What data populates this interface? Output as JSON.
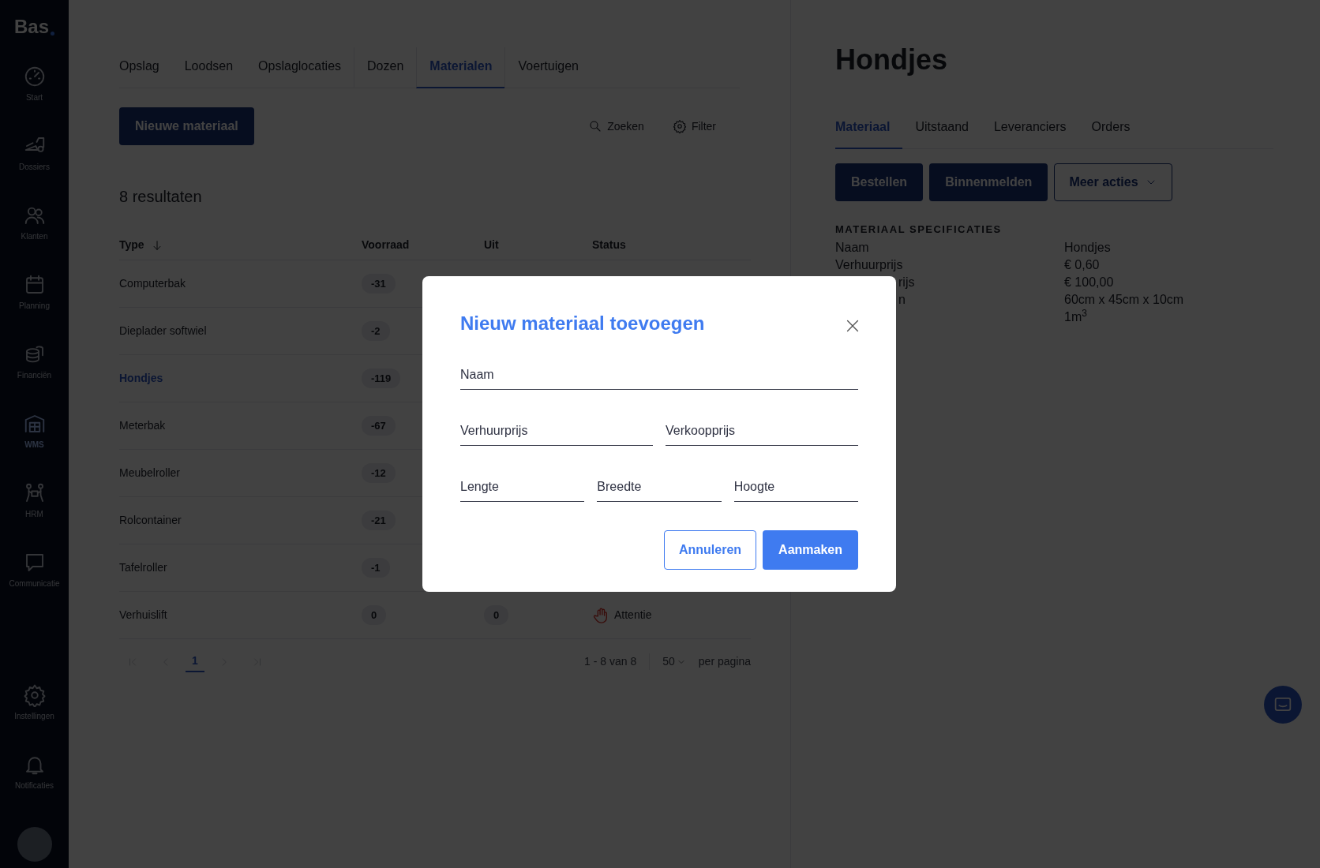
{
  "sidebar": {
    "logo": "Bas",
    "items": [
      {
        "label": "Start",
        "selected": false
      },
      {
        "label": "Dossiers",
        "selected": false
      },
      {
        "label": "Klanten",
        "selected": false
      },
      {
        "label": "Planning",
        "selected": false
      },
      {
        "label": "Financiën",
        "selected": false
      },
      {
        "label": "WMS",
        "selected": true
      },
      {
        "label": "HRM",
        "selected": false
      },
      {
        "label": "Communicatie",
        "selected": false
      }
    ],
    "bottom_items": [
      {
        "label": "Instellingen",
        "selected": false
      },
      {
        "label": "Notificaties",
        "selected": false
      }
    ]
  },
  "tabs": [
    {
      "label": "Opslag",
      "selected": false
    },
    {
      "label": "Loodsen",
      "selected": false
    },
    {
      "label": "Opslaglocaties",
      "selected": false
    },
    {
      "label": "Dozen",
      "selected": false
    },
    {
      "label": "Materialen",
      "selected": true
    },
    {
      "label": "Voertuigen",
      "selected": false
    }
  ],
  "new_button": "Nieuwe materiaal",
  "search": "Zoeken",
  "filter": "Filter",
  "results": "8 resultaten",
  "table": {
    "columns": [
      "Type",
      "Voorraad",
      "Uit",
      "Status"
    ],
    "rows": [
      {
        "type": "Computerbak",
        "stock": "-31",
        "selected": false
      },
      {
        "type": "Dieplader softwiel",
        "stock": "-2",
        "selected": false
      },
      {
        "type": "Hondjes",
        "stock": "-119",
        "selected": true
      },
      {
        "type": "Meterbak",
        "stock": "-67",
        "selected": false
      },
      {
        "type": "Meubelroller",
        "stock": "-12",
        "selected": false
      },
      {
        "type": "Rolcontainer",
        "stock": "-21",
        "selected": false
      },
      {
        "type": "Tafelroller",
        "stock": "-1",
        "selected": false
      },
      {
        "type": "Verhuislift",
        "stock": "0",
        "selected": false,
        "out": "0",
        "status": "Attentie"
      }
    ]
  },
  "pagination": {
    "pages": [
      {
        "label": "1",
        "selected": true
      }
    ],
    "range": "1 - 8 van 8",
    "per_page": "50",
    "per_page_label": "per pagina"
  },
  "detail": {
    "title": "Hondjes",
    "tabs": [
      {
        "label": "Materiaal",
        "selected": true
      },
      {
        "label": "Uitstaand",
        "selected": false
      },
      {
        "label": "Leveranciers",
        "selected": false
      },
      {
        "label": "Orders",
        "selected": false
      }
    ],
    "buttons": [
      {
        "label": "Bestellen",
        "kind": "primary"
      },
      {
        "label": "Binnenmelden",
        "kind": "primary"
      },
      {
        "label": "Meer acties",
        "kind": "dropdown"
      }
    ],
    "spec_heading": "MATERIAAL SPECIFICATIES",
    "specs": [
      {
        "label": "Naam",
        "value": "Hondjes"
      },
      {
        "label": "Verhuurprijs",
        "value": "€ 0,60"
      },
      {
        "label": "rijs",
        "partial": true,
        "value": "€ 100,00"
      },
      {
        "label": "n",
        "partial": true,
        "value": "60cm x 45cm x 10cm"
      },
      {
        "value": "1m$^{3}$"
      }
    ]
  },
  "modal": {
    "title": "Nieuw materiaal toevoegen",
    "field_rows": [
      [
        {
          "placeholder": "Naam"
        }
      ],
      [
        {
          "placeholder": "Verhuurprijs"
        },
        {
          "placeholder": "Verkoopprijs"
        }
      ],
      [
        {
          "placeholder": "Lengte"
        },
        {
          "placeholder": "Breedte"
        },
        {
          "placeholder": "Hoogte"
        }
      ]
    ],
    "buttons": [
      {
        "label": "Annuleren",
        "kind": "outline"
      },
      {
        "label": "Aanmaken",
        "kind": "primary"
      }
    ]
  }
}
